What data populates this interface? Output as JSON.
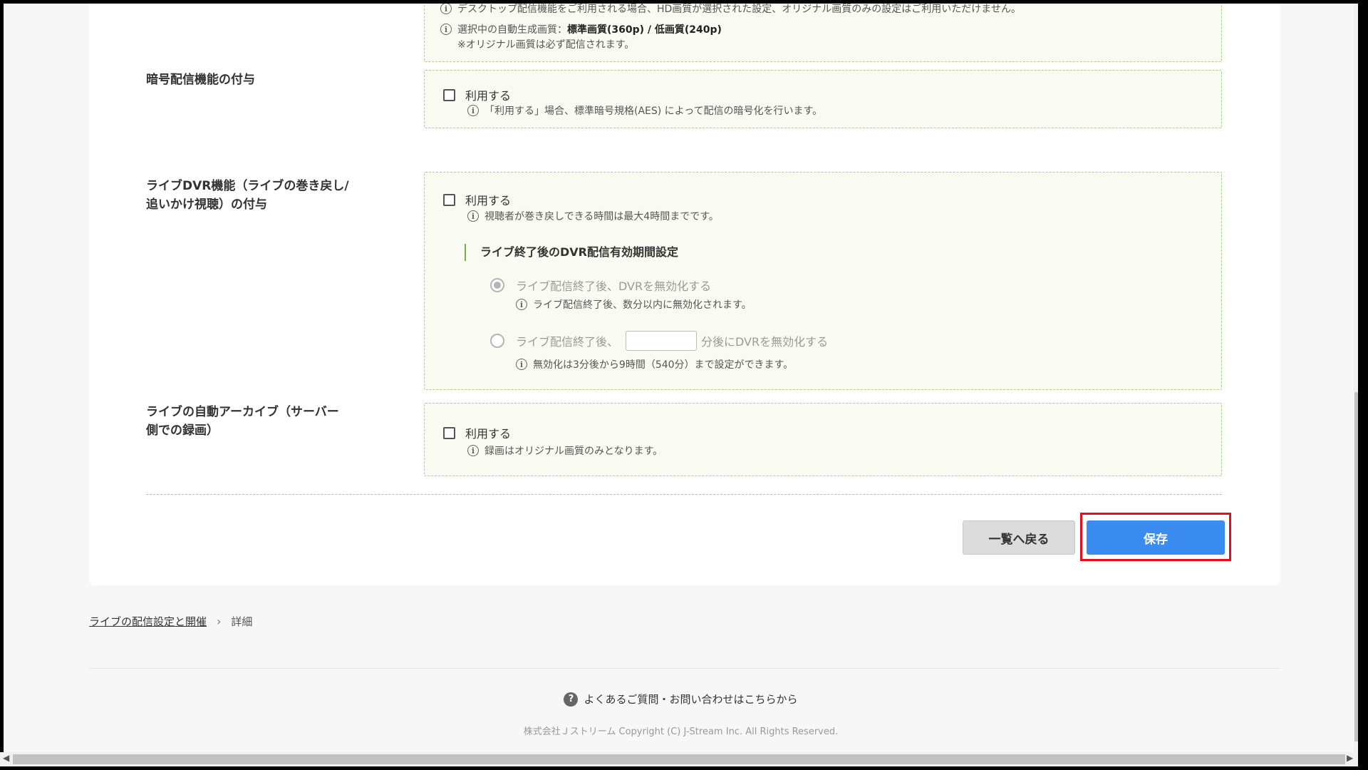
{
  "top_box": {
    "line1": "デスクトップ配信機能をご利用される場合、HD画質が選択された設定、オリジナル画質のみの設定はご利用いただけません。",
    "line2_prefix": "選択中の自動生成画質：",
    "line2_value": "標準画質(360p) / 低画質(240p)",
    "line3": "※オリジナル画質は必ず配信されます。"
  },
  "encryption": {
    "label": "暗号配信機能の付与",
    "checkbox_label": "利用する",
    "info": "「利用する」場合、標準暗号規格(AES) によって配信の暗号化を行います。"
  },
  "dvr": {
    "label_line1": "ライブDVR機能（ライブの巻き戻し/",
    "label_line2": "追いかけ視聴）の付与",
    "checkbox_label": "利用する",
    "info": "視聴者が巻き戻しできる時間は最大4時間までです。",
    "sub_heading": "ライブ終了後のDVR配信有効期間設定",
    "option1_label": "ライブ配信終了後、DVRを無効化する",
    "option1_info": "ライブ配信終了後、数分以内に無効化されます。",
    "option2_prefix": "ライブ配信終了後、",
    "option2_value": "",
    "option2_suffix": "分後にDVRを無効化する",
    "option2_info": "無効化は3分後から9時間（540分）まで設定ができます。"
  },
  "archive": {
    "label_line1": "ライブの自動アーカイブ（サーバー",
    "label_line2": "側での録画）",
    "checkbox_label": "利用する",
    "info": "録画はオリジナル画質のみとなります。"
  },
  "buttons": {
    "back_label": "一覧へ戻る",
    "save_label": "保存"
  },
  "breadcrumb": {
    "link": "ライブの配信設定と開催",
    "current": "詳細"
  },
  "footer": {
    "faq": "よくあるご質問・お問い合わせはこちらから",
    "copyright": "株式会社Ｊストリーム Copyright (C) J-Stream Inc. All Rights Reserved."
  },
  "colors": {
    "save_button": "#3b8cf0",
    "highlight": "#e01020",
    "box_border": "#a9d38a"
  }
}
